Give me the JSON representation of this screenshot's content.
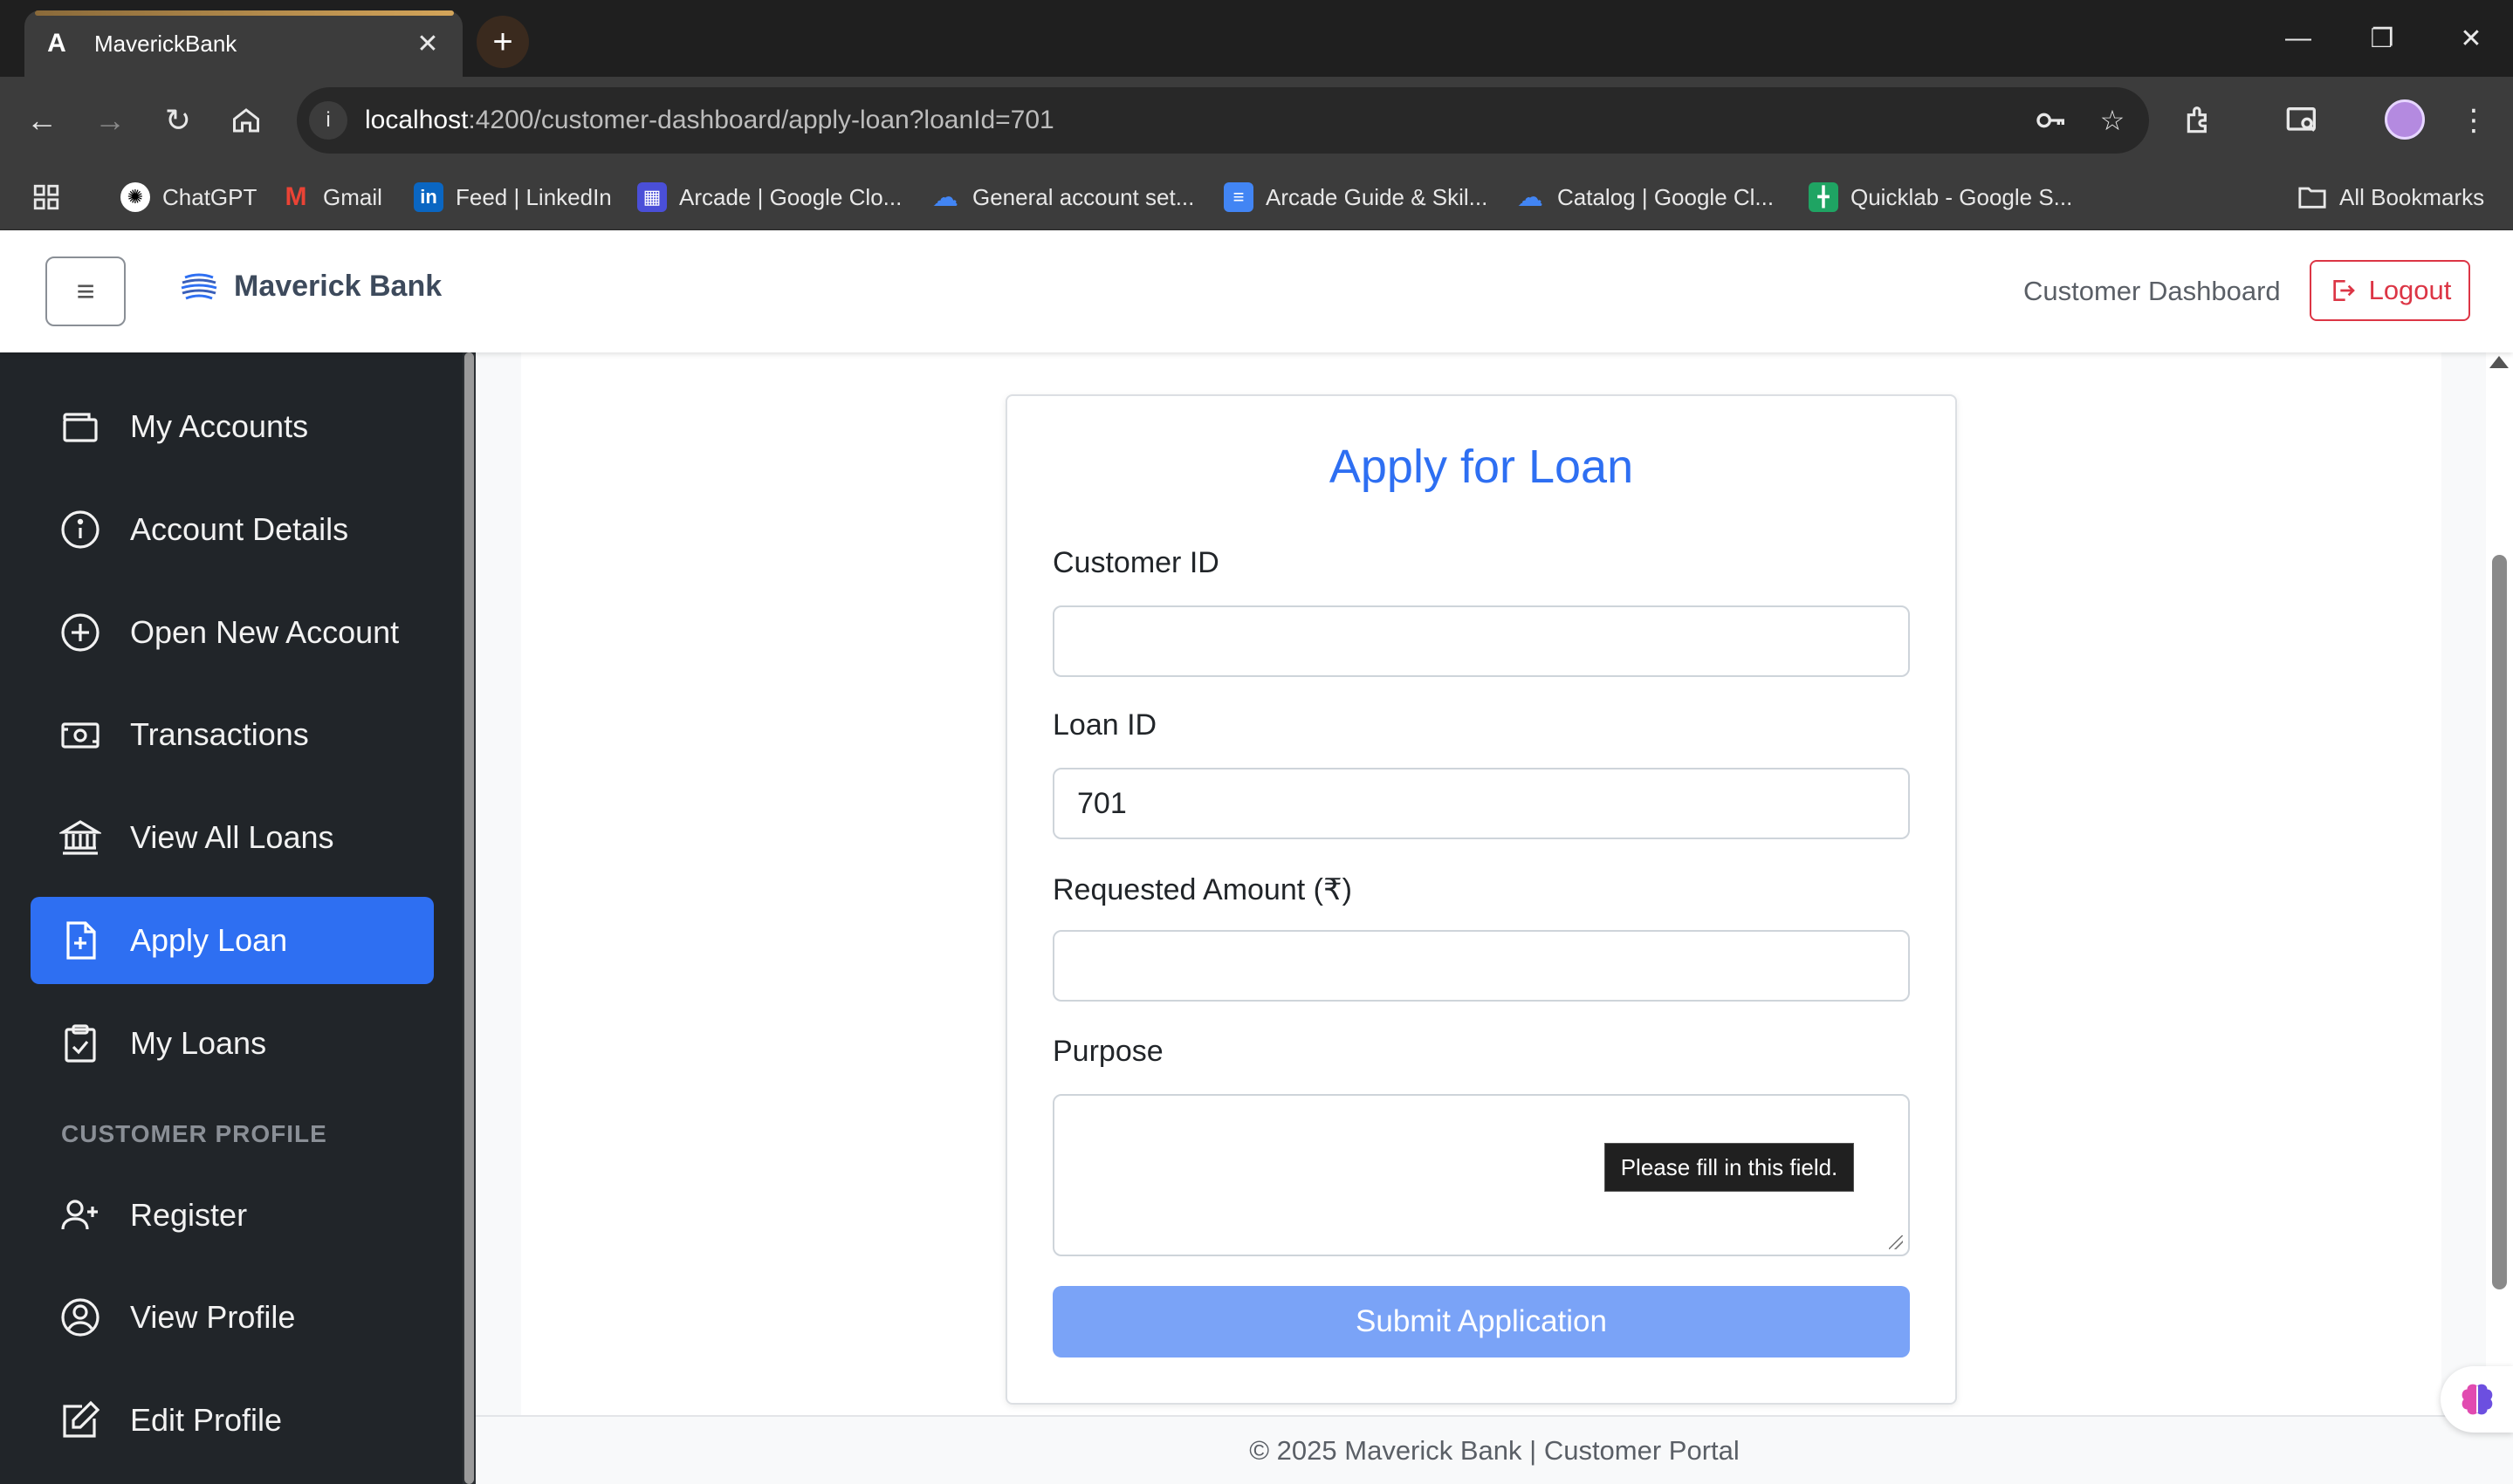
{
  "browser": {
    "tab_title": "MaverickBank",
    "url_host": "localhost",
    "url_rest": ":4200/customer-dashboard/apply-loan?loanId=701",
    "bookmarks": [
      {
        "label": "ChatGPT",
        "icon": "chatgpt-icon"
      },
      {
        "label": "Gmail",
        "icon": "gmail-icon"
      },
      {
        "label": "Feed | LinkedIn",
        "icon": "linkedin-icon"
      },
      {
        "label": "Arcade | Google Clo...",
        "icon": "arcade-icon"
      },
      {
        "label": "General account set...",
        "icon": "google-cloud-icon"
      },
      {
        "label": "Arcade Guide & Skil...",
        "icon": "docs-icon"
      },
      {
        "label": "Catalog | Google Cl...",
        "icon": "google-cloud-icon"
      },
      {
        "label": "Quicklab - Google S...",
        "icon": "sheets-icon"
      }
    ],
    "all_bookmarks": "All Bookmarks"
  },
  "header": {
    "brand": "Maverick Bank",
    "nav_link": "Customer Dashboard",
    "logout": "Logout"
  },
  "sidebar": {
    "items": [
      {
        "label": "My Accounts",
        "icon": "wallet-icon"
      },
      {
        "label": "Account Details",
        "icon": "info-icon"
      },
      {
        "label": "Open New Account",
        "icon": "plus-circle-icon"
      },
      {
        "label": "Transactions",
        "icon": "cash-icon"
      },
      {
        "label": "View All Loans",
        "icon": "bank-icon"
      },
      {
        "label": "Apply Loan",
        "icon": "file-plus-icon",
        "active": true
      },
      {
        "label": "My Loans",
        "icon": "clipboard-check-icon"
      }
    ],
    "profile_heading": "CUSTOMER PROFILE",
    "profile_items": [
      {
        "label": "Register",
        "icon": "person-plus-icon"
      },
      {
        "label": "View Profile",
        "icon": "person-circle-icon"
      },
      {
        "label": "Edit Profile",
        "icon": "pencil-square-icon"
      }
    ]
  },
  "form": {
    "title": "Apply for Loan",
    "customer_id": {
      "label": "Customer ID",
      "value": ""
    },
    "loan_id": {
      "label": "Loan ID",
      "value": "701"
    },
    "amount": {
      "label": "Requested Amount (₹)",
      "value": ""
    },
    "purpose": {
      "label": "Purpose",
      "value": ""
    },
    "tooltip": "Please fill in this field.",
    "submit": "Submit Application"
  },
  "footer": {
    "text": "© 2025 Maverick Bank | Customer Portal"
  },
  "colors": {
    "primary": "#2e6ff2",
    "sidebar_bg": "#212529",
    "danger": "#dc3545",
    "submit_disabled": "#7aa3f7"
  }
}
